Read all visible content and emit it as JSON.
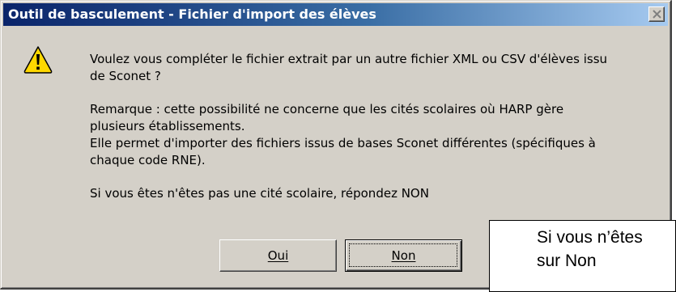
{
  "dialog": {
    "title": "Outil de basculement - Fichier d'import des élèves",
    "icon": "warning-icon",
    "message_lines": [
      "Voulez vous compléter le fichier extrait par un autre fichier XML ou CSV d'élèves issu",
      "de Sconet ?",
      "Remarque : cette possibilité ne concerne que les cités scolaires où HARP gère",
      "plusieurs établissements.",
      "Elle permet d'importer des fichiers issus de bases Sconet différentes (spécifiques à",
      "chaque code RNE).",
      "Si vous êtes n'êtes pas une cité scolaire, répondez NON"
    ],
    "buttons": {
      "yes_label": "Oui",
      "no_label": "Non"
    }
  },
  "note": {
    "line1": "Si vous n’êtes",
    "line2": "sur Non"
  },
  "colors": {
    "title_start": "#0a246a",
    "title_end": "#a6caf0",
    "face": "#d4d0c8",
    "warning": "#ffd800"
  }
}
